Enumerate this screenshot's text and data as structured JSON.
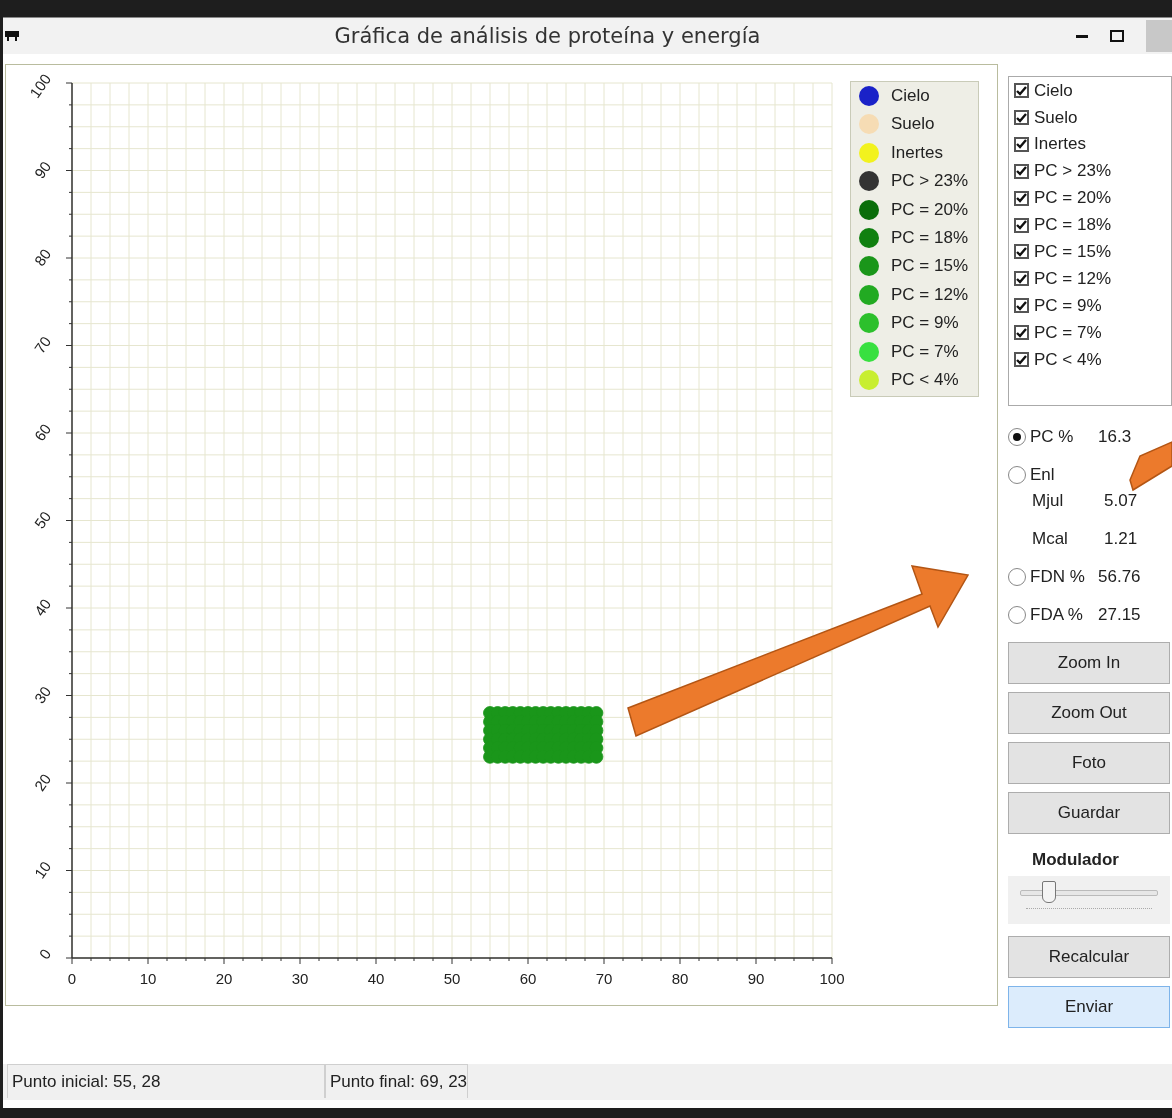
{
  "window": {
    "title": "Gráfica de análisis de proteína y energía"
  },
  "chart": {
    "legend": [
      {
        "label": "Cielo",
        "color": "#1a22c8"
      },
      {
        "label": "Suelo",
        "color": "#f6dcb4"
      },
      {
        "label": "Inertes",
        "color": "#f2f21e"
      },
      {
        "label": "PC > 23%",
        "color": "#333333"
      },
      {
        "label": "PC = 20%",
        "color": "#0a6e0a"
      },
      {
        "label": "PC = 18%",
        "color": "#108010"
      },
      {
        "label": "PC = 15%",
        "color": "#1a961a"
      },
      {
        "label": "PC = 12%",
        "color": "#22aa22"
      },
      {
        "label": "PC = 9%",
        "color": "#2cc02c"
      },
      {
        "label": "PC = 7%",
        "color": "#38e040"
      },
      {
        "label": "PC < 4%",
        "color": "#c8ee30"
      }
    ],
    "chart_data": {
      "type": "scatter",
      "grid": true,
      "xlim": [
        0,
        100
      ],
      "ylim": [
        0,
        100
      ],
      "xticks": [
        0,
        10,
        20,
        30,
        40,
        50,
        60,
        70,
        80,
        90,
        100
      ],
      "yticks": [
        0,
        10,
        20,
        30,
        40,
        50,
        60,
        70,
        80,
        90,
        100
      ],
      "x": [
        55,
        56,
        57,
        58,
        59,
        60,
        61,
        62,
        63,
        64,
        65,
        66,
        67,
        68,
        69,
        55,
        56,
        57,
        58,
        59,
        60,
        61,
        62,
        63,
        64,
        65,
        66,
        67,
        68,
        69,
        55,
        56,
        57,
        58,
        59,
        60,
        61,
        62,
        63,
        64,
        65,
        66,
        67,
        68,
        69,
        55,
        56,
        57,
        58,
        59,
        60,
        61,
        62,
        63,
        64,
        65,
        66,
        67,
        68,
        69,
        55,
        56,
        57,
        58,
        59,
        60,
        61,
        62,
        63,
        64,
        65,
        66,
        67,
        68,
        69,
        55,
        56,
        57,
        58,
        59,
        60,
        61,
        62,
        63,
        64,
        65,
        66,
        67,
        68,
        69
      ],
      "series": [
        {
          "color": "#1a961a",
          "values": [
            28,
            28,
            28,
            28,
            28,
            28,
            28,
            28,
            28,
            28,
            28,
            28,
            28,
            28,
            28,
            27,
            27,
            27,
            27,
            27,
            27,
            27,
            27,
            27,
            27,
            27,
            27,
            27,
            27,
            27,
            26,
            26,
            26,
            26,
            26,
            26,
            26,
            26,
            26,
            26,
            26,
            26,
            26,
            26,
            26,
            25,
            25,
            25,
            25,
            25,
            25,
            25,
            25,
            25,
            25,
            25,
            25,
            25,
            25,
            25,
            24,
            24,
            24,
            24,
            24,
            24,
            24,
            24,
            24,
            24,
            24,
            24,
            24,
            24,
            24,
            23,
            23,
            23,
            23,
            23,
            23,
            23,
            23,
            23,
            23,
            23,
            23,
            23,
            23,
            23
          ]
        }
      ]
    }
  },
  "filters": [
    {
      "label": "Cielo",
      "checked": true
    },
    {
      "label": "Suelo",
      "checked": true
    },
    {
      "label": "Inertes",
      "checked": true
    },
    {
      "label": "PC > 23%",
      "checked": true
    },
    {
      "label": "PC = 20%",
      "checked": true
    },
    {
      "label": "PC = 18%",
      "checked": true
    },
    {
      "label": "PC = 15%",
      "checked": true
    },
    {
      "label": "PC = 12%",
      "checked": true
    },
    {
      "label": "PC = 9%",
      "checked": true
    },
    {
      "label": "PC = 7%",
      "checked": true
    },
    {
      "label": "PC < 4%",
      "checked": true
    }
  ],
  "readings": [
    {
      "kind": "radio",
      "label": "PC %",
      "value": "16.3",
      "selected": true
    },
    {
      "kind": "radio",
      "label": "Enl",
      "selected": false
    },
    {
      "kind": "sub",
      "label": "Mjul",
      "value": "5.07"
    },
    {
      "kind": "sub",
      "label": "Mcal",
      "value": "1.21"
    },
    {
      "kind": "radio",
      "label": "FDN %",
      "value": "56.76",
      "selected": false
    },
    {
      "kind": "radio",
      "label": "FDA %",
      "value": "27.15",
      "selected": false
    }
  ],
  "buttons": [
    {
      "label": "Zoom In"
    },
    {
      "label": "Zoom Out"
    },
    {
      "label": "Foto"
    },
    {
      "label": "Guardar"
    }
  ],
  "modulator": {
    "label": "Modulador",
    "level": 0.2
  },
  "actions": [
    {
      "label": "Recalcular",
      "default": false
    },
    {
      "label": "Enviar",
      "default": true
    }
  ],
  "status_bar": [
    "Punto inicial: 55, 28",
    "Punto final: 69, 23"
  ]
}
